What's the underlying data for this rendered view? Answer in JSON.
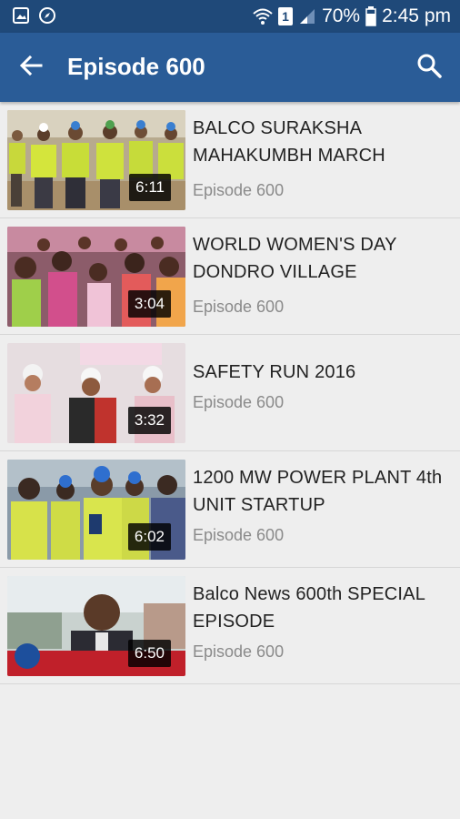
{
  "status_bar": {
    "battery": "70%",
    "time": "2:45 pm",
    "sim": "1"
  },
  "app_bar": {
    "title": "Episode 600",
    "back_icon": "arrow-left-icon",
    "search_icon": "search-icon"
  },
  "colors": {
    "status_bar": "#1f4979",
    "app_bar": "#2a5c97",
    "background": "#eeeeee"
  },
  "videos": [
    {
      "title": "BALCO SURAKSHA MAHAKUMBH MARCH",
      "subtitle": "Episode 600",
      "duration": "6:11"
    },
    {
      "title": "WORLD WOMEN'S DAY DONDRO VILLAGE",
      "subtitle": "Episode 600",
      "duration": "3:04"
    },
    {
      "title": "SAFETY RUN 2016",
      "subtitle": "Episode 600",
      "duration": "3:32"
    },
    {
      "title": "1200 MW POWER PLANT 4th UNIT STARTUP",
      "subtitle": "Episode 600",
      "duration": "6:02"
    },
    {
      "title": "Balco News 600th SPECIAL EPISODE",
      "subtitle": "Episode 600",
      "duration": "6:50"
    }
  ]
}
